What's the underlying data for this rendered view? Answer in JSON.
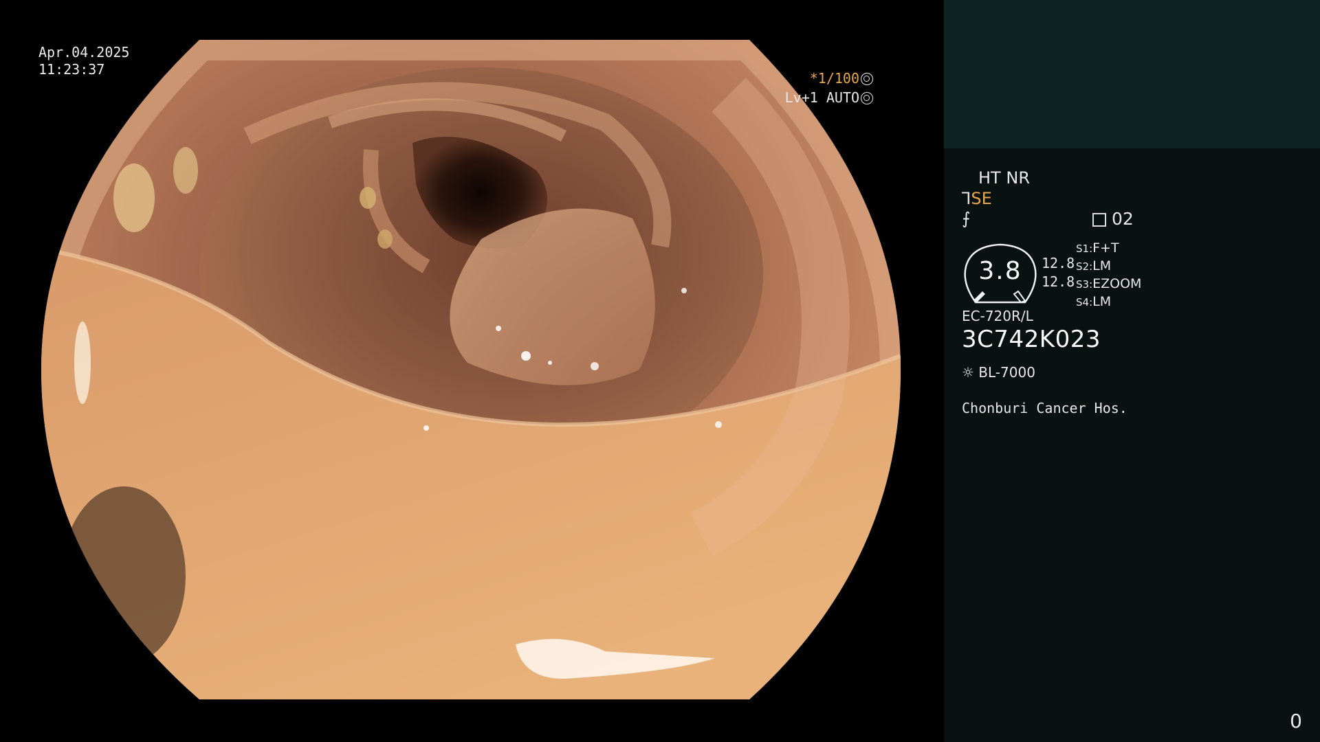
{
  "osd": {
    "date": "Apr.04.2025",
    "time": "11:23:37",
    "zoom_prefix": "*",
    "zoom_value": "1/100",
    "level": "Lv+1",
    "mode": "AUTO"
  },
  "panel": {
    "ht": "HT",
    "nr": "NR",
    "se": "SE",
    "record_count": "02",
    "gauge_value": "3.8",
    "gauge_top": "12.8",
    "gauge_bottom": "12.8",
    "modes": [
      {
        "key": "S1:",
        "value": "F+T"
      },
      {
        "key": "S2:",
        "value": "LM"
      },
      {
        "key": "S3:",
        "value": "EZOOM"
      },
      {
        "key": "S4:",
        "value": "LM"
      }
    ],
    "scope_model": "EC-720R/L",
    "serial": "3C742K023",
    "light_source": "BL-7000",
    "hospital": "Chonburi Cancer Hos.",
    "counter": "0"
  },
  "colors": {
    "accent": "#e8a84a",
    "panel_bg": "#0a1111",
    "panel_top_bg": "#0c2323"
  }
}
